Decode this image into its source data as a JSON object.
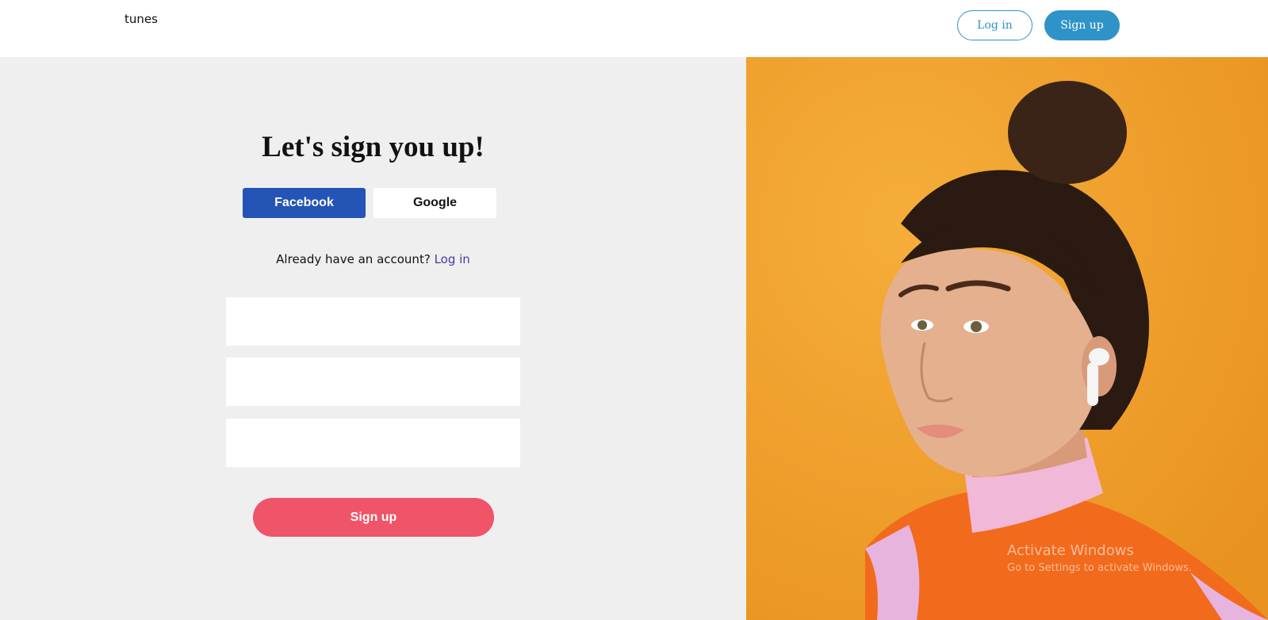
{
  "header": {
    "brand": "tunes",
    "login_label": "Log in",
    "signup_label": "Sign up"
  },
  "form": {
    "heading": "Let's sign you up!",
    "facebook_label": "Facebook",
    "google_label": "Google",
    "already_text": "Already have an account?",
    "login_link": "Log in",
    "field1_value": "",
    "field2_value": "",
    "field3_value": "",
    "submit_label": "Sign up"
  },
  "hero": {
    "image": "woman-with-earbud-photo",
    "bg_color": "#f0a030"
  },
  "watermark": {
    "title": "Activate Windows",
    "subtitle": "Go to Settings to activate Windows."
  },
  "colors": {
    "primary": "#2f93c8",
    "facebook": "#2454b5",
    "submit": "#ef5468"
  }
}
